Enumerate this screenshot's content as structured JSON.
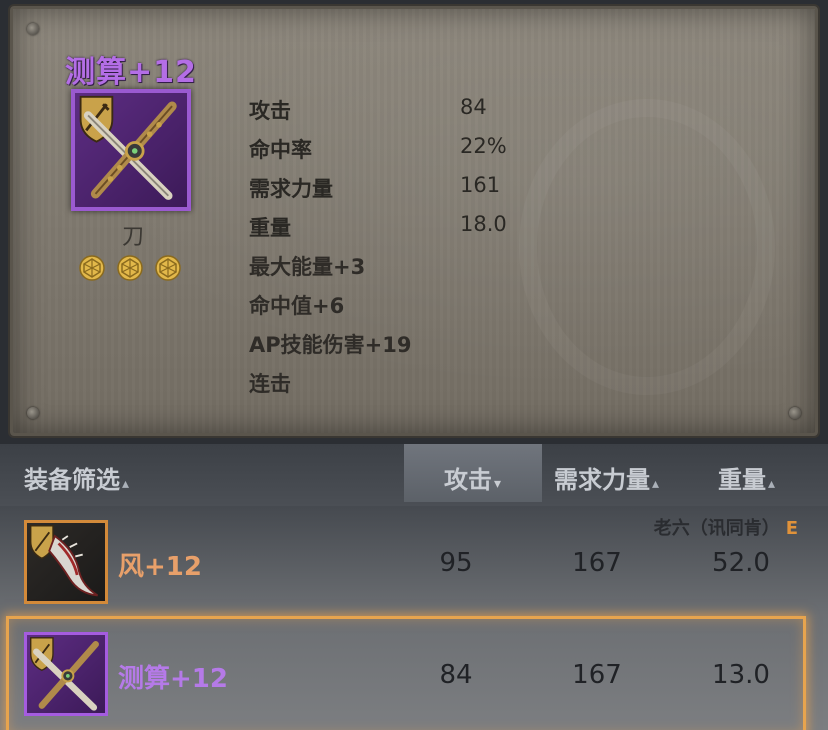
{
  "item": {
    "title": "测算+12",
    "type": "刀",
    "gem_count": 3,
    "stats": [
      {
        "label": "攻击",
        "value": "84"
      },
      {
        "label": "命中率",
        "value": "22%"
      },
      {
        "label": "需求力量",
        "value": "161"
      },
      {
        "label": "重量",
        "value": "18.0"
      }
    ],
    "bonuses": [
      "最大能量+3",
      "命中值+6",
      "AP技能伤害+19",
      "连击"
    ]
  },
  "list": {
    "header": {
      "filter": "装备筛选",
      "attack": "攻击",
      "strength": "需求力量",
      "weight": "重量",
      "sort_active": "attack",
      "arrow_down": "▾",
      "arrow_up": "▴"
    },
    "owner": {
      "name": "老六（讯同肯）",
      "grade": "E"
    },
    "rows": [
      {
        "name": "风+12",
        "attack": "95",
        "strength": "167",
        "weight": "52.0",
        "rarity": "orange",
        "selected": false
      },
      {
        "name": "测算+12",
        "attack": "84",
        "strength": "167",
        "weight": "13.0",
        "rarity": "purple",
        "selected": true
      }
    ]
  },
  "colors": {
    "purple": "#b46ee6",
    "orange": "#e8a06a",
    "highlight": "#e7a44e"
  }
}
